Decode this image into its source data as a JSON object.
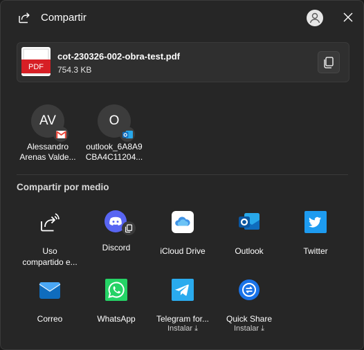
{
  "window": {
    "title": "Compartir"
  },
  "file": {
    "name": "cot-230326-002-obra-test.pdf",
    "size": "754.3 KB",
    "thumb_label": "PDF"
  },
  "contacts": [
    {
      "initials": "AV",
      "name_line1": "Alessandro",
      "name_line2": "Arenas Valde...",
      "badge": "gmail-icon"
    },
    {
      "initials": "O",
      "name_line1": "outlook_6A8A9",
      "name_line2": "CBA4C11204...",
      "badge": "outlook-icon"
    }
  ],
  "share_section": {
    "title": "Compartir por medio"
  },
  "apps": [
    {
      "label_line1": "Uso",
      "label_line2": "compartido e...",
      "icon": "nearby-share-icon"
    },
    {
      "label_line1": "Discord",
      "icon": "discord-icon"
    },
    {
      "label_line1": "iCloud Drive",
      "icon": "icloud-icon"
    },
    {
      "label_line1": "Outlook",
      "icon": "outlook-icon"
    },
    {
      "label_line1": "Twitter",
      "icon": "twitter-icon"
    },
    {
      "label_line1": "Correo",
      "icon": "mail-icon"
    },
    {
      "label_line1": "WhatsApp",
      "icon": "whatsapp-icon"
    },
    {
      "label_line1": "Telegram for...",
      "sub": "Instalar ⤓",
      "icon": "telegram-icon"
    },
    {
      "label_line1": "Quick Share",
      "sub": "Instalar ⤓",
      "icon": "quick-share-icon"
    }
  ],
  "colors": {
    "background": "#262626",
    "card": "#2f2f2f",
    "pdf_red": "#d71f25",
    "discord": "#5865f2",
    "outlook": "#0f6cbd",
    "twitter": "#1d9bf0",
    "whatsapp": "#25d366",
    "telegram": "#2aabee",
    "quick_share": "#1a73e8"
  }
}
